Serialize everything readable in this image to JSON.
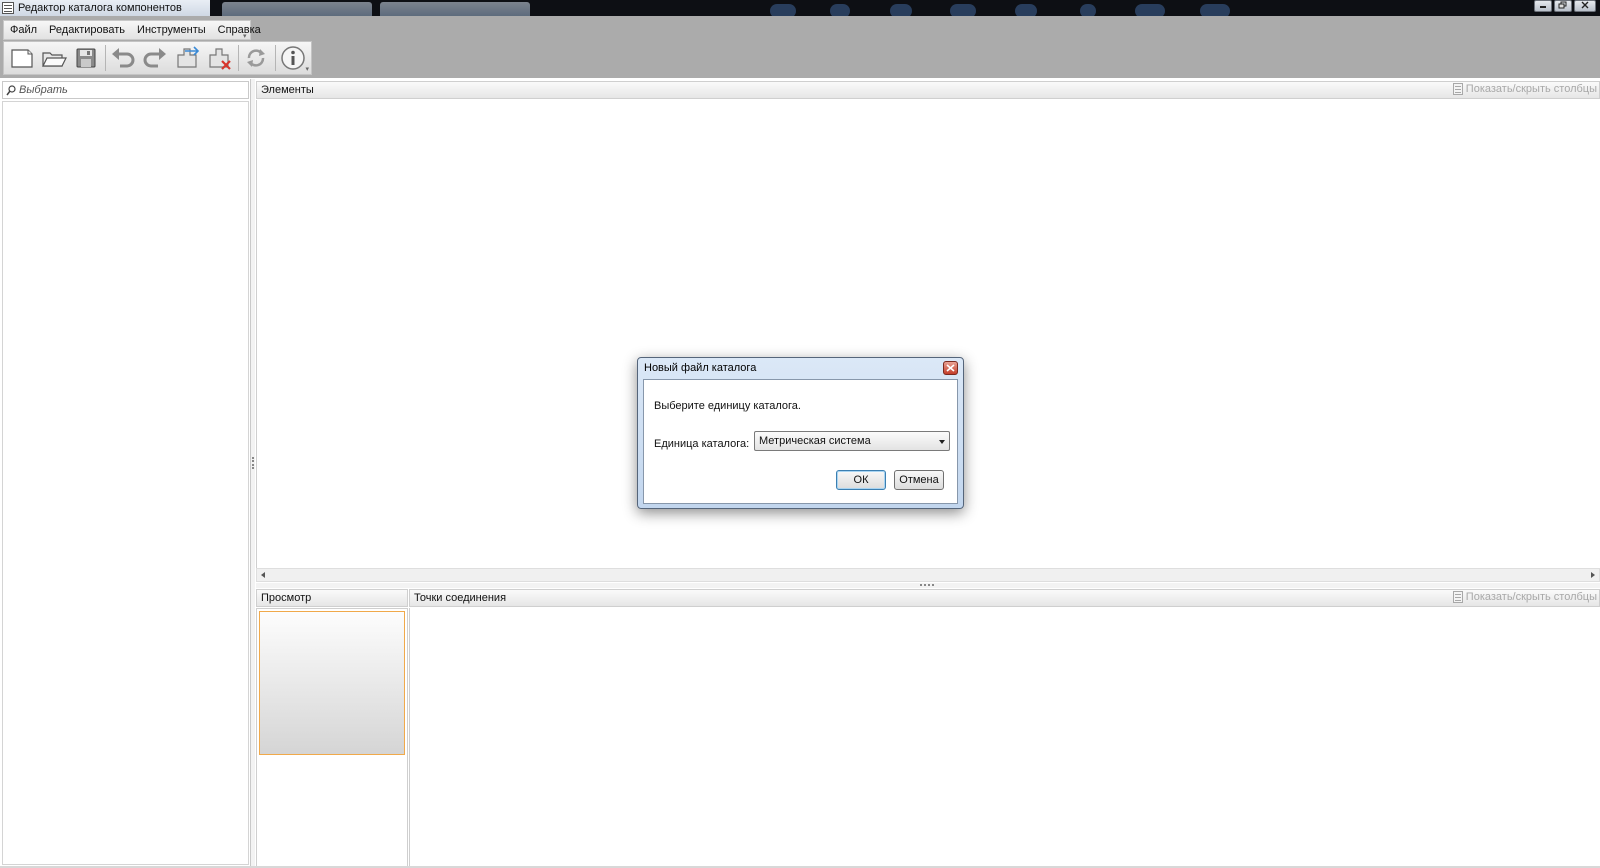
{
  "window": {
    "title": "Редактор каталога компонентов"
  },
  "menu": {
    "items": [
      "Файл",
      "Редактировать",
      "Инструменты",
      "Справка"
    ]
  },
  "toolbar": {
    "icons": [
      "new-file-icon",
      "open-folder-icon",
      "save-icon",
      "undo-icon",
      "redo-icon",
      "add-component-icon",
      "delete-component-icon",
      "refresh-icon",
      "info-icon"
    ]
  },
  "left_panel": {
    "search_placeholder": "Выбрать"
  },
  "elements_pane": {
    "title": "Элементы",
    "toggle_columns": "Показать/скрыть столбцы"
  },
  "preview_pane": {
    "title": "Просмотр"
  },
  "connections_pane": {
    "title": "Точки соединения",
    "toggle_columns": "Показать/скрыть столбцы"
  },
  "dialog": {
    "title": "Новый файл каталога",
    "prompt": "Выберите единицу каталога.",
    "unit_label": "Единица каталога:",
    "unit_value": "Метрическая система",
    "ok_label": "ОК",
    "cancel_label": "Отмена"
  },
  "colors": {
    "band_gray": "#ababab",
    "dialog_frame": "#c2d6ee",
    "preview_border": "#f0a94a",
    "close_red": "#c43d2a"
  }
}
